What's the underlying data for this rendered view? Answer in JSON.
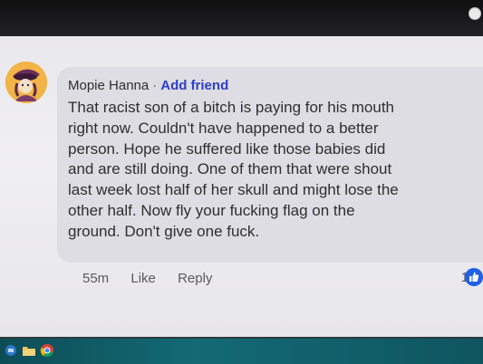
{
  "comment": {
    "author": "Mopie Hanna",
    "separator": "·",
    "add_friend_label": "Add friend",
    "text": "That racist son of a bitch is paying for his mouth\nright now.  Couldn't have happened to a better\nperson. Hope he suffered like those babies did\nand are still doing. One of them that were shout\nlast week lost half of her skull and might lose the\nother half.  Now fly your fucking flag on the\nground.  Don't give one fuck.",
    "timestamp": "55m",
    "like_label": "Like",
    "reply_label": "Reply",
    "reaction_count": "1"
  },
  "icons": {
    "avatar": "profile-avatar",
    "reaction": "like-thumb-icon",
    "taskbar": [
      "start-orb-icon",
      "folder-icon",
      "chrome-icon"
    ]
  },
  "colors": {
    "add_friend": "#2d3fc6",
    "reaction_blue": "#1f62e6",
    "bubble": "#dedde3",
    "taskbar": "#136a74"
  }
}
